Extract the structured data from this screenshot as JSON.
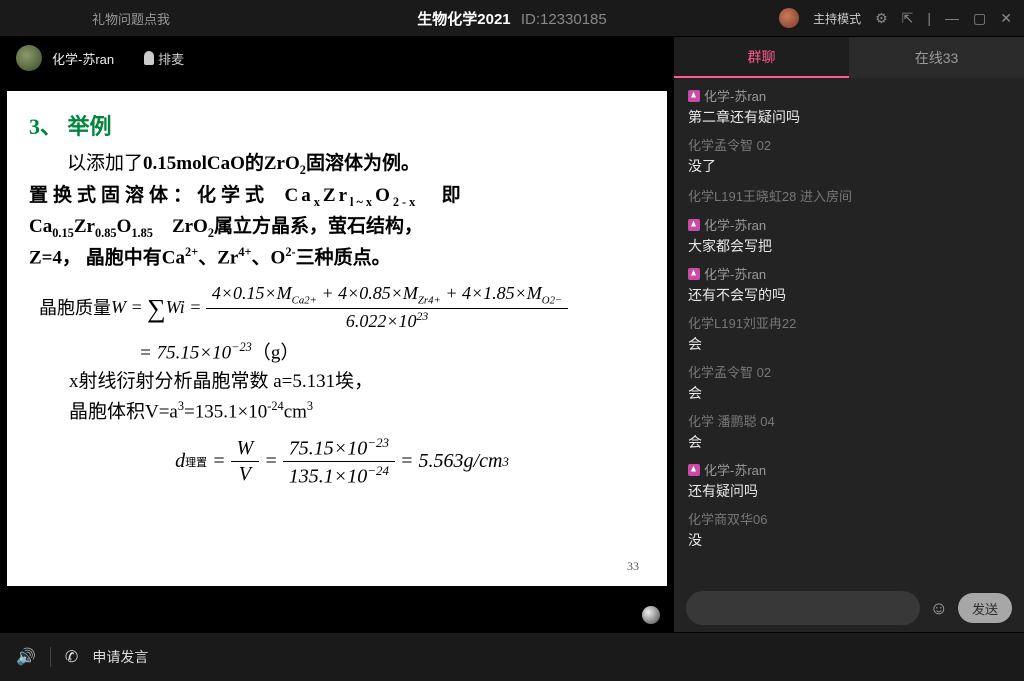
{
  "titlebar": {
    "left_note": "礼物问题点我",
    "course_title": "生物化学2021",
    "course_id": "ID:12330185",
    "mode_label": "主持模式"
  },
  "presenter": {
    "name": "化学-苏ran",
    "queue_label": "排麦"
  },
  "slide": {
    "section_title": "3、 举例",
    "line1_a": "以添加了",
    "line1_b": "0.15molCaO的ZrO",
    "line1_c": "固溶体为例。",
    "line2_a": "置换式固溶体：化学式  Ca",
    "line2_b": "Zr",
    "line2_c": "O",
    "line2_d": "   即",
    "line3_a": "Ca",
    "line3_b": "Zr",
    "line3_c": "O",
    "line3_d": "    ZrO",
    "line3_e": "属立方晶系，萤石结构，",
    "line4_a": "Z=4",
    "line4_b": "， 晶胞中有Ca",
    "line4_c": "、Zr",
    "line4_d": "、O",
    "line4_e": "三种质点。",
    "eq1_lhs": "晶胞质量",
    "eq1_num": "4×0.15×M",
    "eq1_num2": " + 4×0.85×M",
    "eq1_num3": " + 4×1.85×M",
    "eq1_den": "6.022×10",
    "eq2": "= 75.15×10",
    "eq2_unit": "（g）",
    "line5": "x射线衍射分析晶胞常数    a=5.131埃，",
    "line6_a": "晶胞体积V=a",
    "line6_b": "=135.1×10",
    "line6_c": "cm",
    "eq3_lhs": "d",
    "eq3_sub": "理置",
    "eq3_eq": " = ",
    "eq3_f1n": "W",
    "eq3_f1d": "V",
    "eq3_f2n": "75.15×10",
    "eq3_f2d": "135.1×10",
    "eq3_res": " = 5.563g / cm",
    "pageno": "33"
  },
  "chat": {
    "tab_group": "群聊",
    "tab_online": "在线33",
    "send_label": "发送",
    "messages": [
      {
        "type": "teacher",
        "user": "化学-苏ran",
        "text": "第二章还有疑问吗"
      },
      {
        "type": "student",
        "user": "化学孟令智  02",
        "text": "没了"
      },
      {
        "type": "system",
        "text": "化学L191王晓虹28 进入房间"
      },
      {
        "type": "teacher",
        "user": "化学-苏ran",
        "text": "大家都会写把"
      },
      {
        "type": "teacher",
        "user": "化学-苏ran",
        "text": "还有不会写的吗"
      },
      {
        "type": "student",
        "user": "化学L191刘亚冉22",
        "text": "会"
      },
      {
        "type": "student",
        "user": "化学孟令智  02",
        "text": "会"
      },
      {
        "type": "student",
        "user": "化学 潘鹏聪 04",
        "text": "会"
      },
      {
        "type": "teacher",
        "user": "化学-苏ran",
        "text": "还有疑问吗"
      },
      {
        "type": "student",
        "user": "化学商双华06",
        "text": "没"
      }
    ]
  },
  "bottombar": {
    "speak_label": "申请发言"
  }
}
